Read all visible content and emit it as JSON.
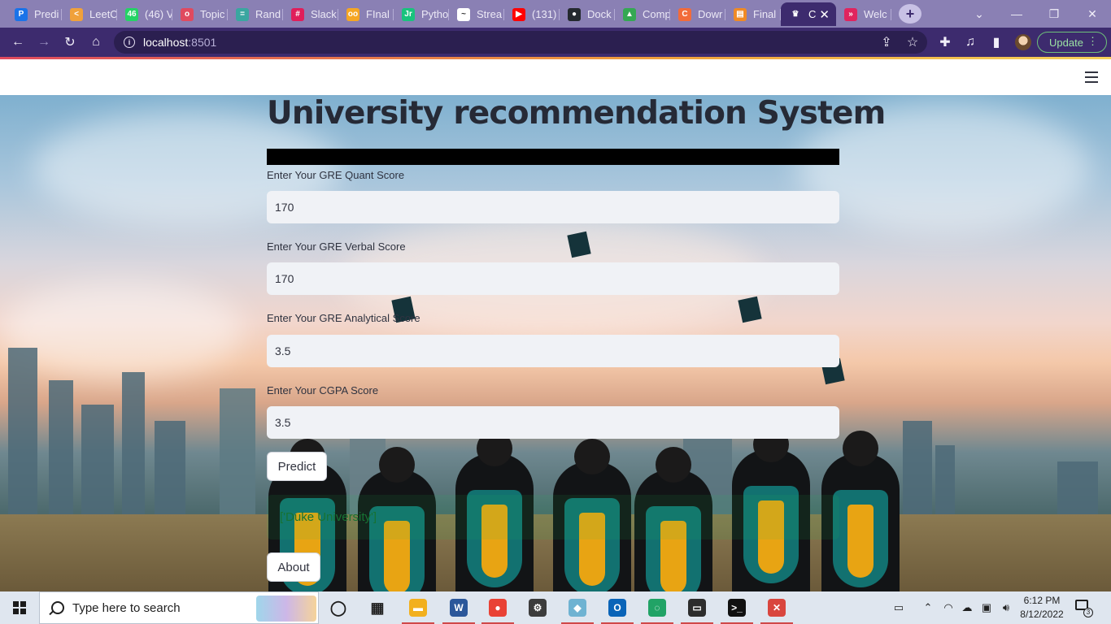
{
  "browser": {
    "tabs": [
      {
        "label": "Predi",
        "color": "#1a73e8",
        "glyph": "P"
      },
      {
        "label": "LeetC",
        "color": "#f0a13b",
        "glyph": "<"
      },
      {
        "label": "(46) V",
        "color": "#25d366",
        "glyph": "46"
      },
      {
        "label": "Topic",
        "color": "#e04a5f",
        "glyph": "o"
      },
      {
        "label": "Rand",
        "color": "#3aa6a0",
        "glyph": "="
      },
      {
        "label": "Slack",
        "color": "#e01e5a",
        "glyph": "#"
      },
      {
        "label": "FInal",
        "color": "#f5a623",
        "glyph": "oo"
      },
      {
        "label": "Pytho",
        "color": "#19c37d",
        "glyph": "Jr"
      },
      {
        "label": "Strea",
        "color": "#ffffff",
        "glyph": "~"
      },
      {
        "label": "(131)",
        "color": "#ff0000",
        "glyph": "▶"
      },
      {
        "label": "Dock",
        "color": "#24292f",
        "glyph": "●"
      },
      {
        "label": "Comp",
        "color": "#34a853",
        "glyph": "▲"
      },
      {
        "label": "Dowr",
        "color": "#f26b3a",
        "glyph": "C"
      },
      {
        "label": "Final",
        "color": "#f08a24",
        "glyph": "▤"
      },
      {
        "label": "C",
        "color": "#3d2b6e",
        "glyph": "♛"
      },
      {
        "label": "Welc",
        "color": "#e0245e",
        "glyph": "»"
      }
    ],
    "new_tab_symbol": "+",
    "window_controls": {
      "dropdown": "⌄",
      "minimize": "—",
      "restore": "❐",
      "close": "✕"
    },
    "address": {
      "host": "localhost",
      "port": ":8501"
    },
    "update_label": "Update",
    "toolbar_icons": {
      "back": "←",
      "forward": "→",
      "reload": "↻",
      "home": "⌂",
      "share": "⇪",
      "star": "☆",
      "extensions": "✚",
      "media": "♫",
      "sidepanel": "▮",
      "menu": "⋮"
    }
  },
  "app": {
    "title": "University recommendation System",
    "fields": [
      {
        "label": "Enter Your GRE Quant Score",
        "value": "170"
      },
      {
        "label": "Enter Your GRE Verbal Score",
        "value": "170"
      },
      {
        "label": "Enter Your GRE Analytical Score",
        "value": "3.5"
      },
      {
        "label": "Enter Your CGPA Score",
        "value": "3.5"
      }
    ],
    "predict_label": "Predict",
    "result_text": "['Duke University']",
    "about_label": "About"
  },
  "taskbar": {
    "search_placeholder": "Type here to search",
    "apps": [
      {
        "name": "task-view",
        "glyph": "◯",
        "color": "#1f1f1f"
      },
      {
        "name": "widgets",
        "glyph": "▦",
        "color": "#1f1f1f"
      },
      {
        "name": "file-explorer",
        "glyph": "▬",
        "color": "#f2b01e"
      },
      {
        "name": "word",
        "glyph": "W",
        "color": "#2b579a"
      },
      {
        "name": "chrome",
        "glyph": "●",
        "color": "#e94235"
      },
      {
        "name": "settings",
        "glyph": "⚙",
        "color": "#3c3c3c"
      },
      {
        "name": "notes",
        "glyph": "◆",
        "color": "#6fb3d2"
      },
      {
        "name": "outlook",
        "glyph": "O",
        "color": "#0a64b8"
      },
      {
        "name": "loader",
        "glyph": "◌",
        "color": "#21a366"
      },
      {
        "name": "terminal",
        "glyph": "▭",
        "color": "#2d2d2d"
      },
      {
        "name": "cmd",
        "glyph": ">_",
        "color": "#111111"
      },
      {
        "name": "xampp",
        "glyph": "✕",
        "color": "#d9463e"
      }
    ],
    "time": "6:12 PM",
    "date": "8/12/2022",
    "notification_count": "3"
  }
}
